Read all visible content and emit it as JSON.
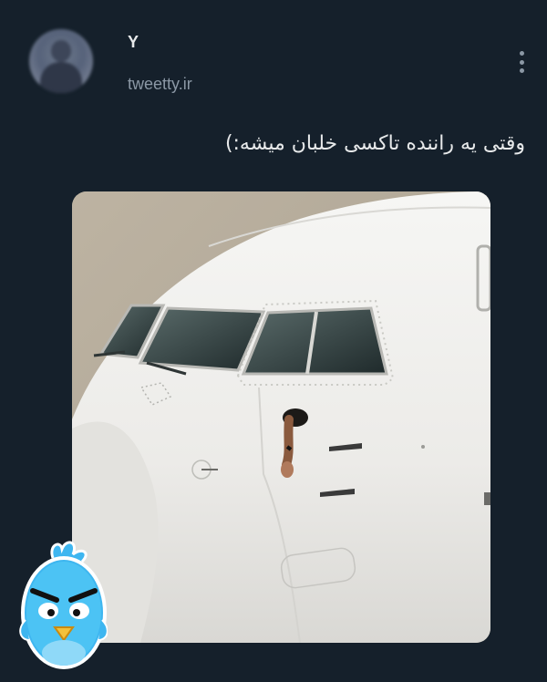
{
  "tweet": {
    "author_name": "Y",
    "author_handle": "tweetty.ir",
    "text": "وقتی یه راننده تاکسی خلبان میشه:)"
  },
  "icons": {
    "avatar": "blurred-profile-photo",
    "more": "more-vertical-icon",
    "sticker": "angry-blue-bird-sticker"
  },
  "media": {
    "subject": "airplane-cockpit-arm-out-window"
  },
  "colors": {
    "background": "#15202b",
    "primary_text": "#e7e9ea",
    "secondary_text": "#8b98a5",
    "bird_blue": "#3eb6f0"
  }
}
